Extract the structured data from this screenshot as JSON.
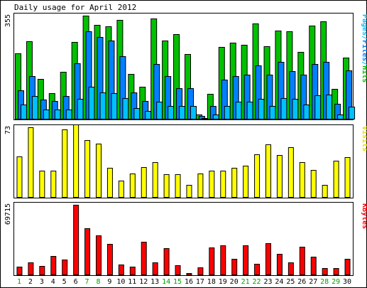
{
  "chart_data": {
    "type": "bar",
    "title": "Daily usage for April 2012",
    "days": [
      "1",
      "2",
      "3",
      "4",
      "5",
      "6",
      "7",
      "8",
      "9",
      "10",
      "11",
      "12",
      "13",
      "14",
      "15",
      "16",
      "17",
      "18",
      "19",
      "20",
      "21",
      "22",
      "23",
      "24",
      "25",
      "26",
      "27",
      "28",
      "29",
      "30"
    ],
    "weekend_days": [
      "1",
      "7",
      "8",
      "14",
      "15",
      "21",
      "22",
      "28",
      "29"
    ],
    "panels": [
      {
        "id": "pages",
        "max_label": "355",
        "ymax": 355,
        "legend": [
          {
            "text": "Pages",
            "color": "#00C0FF"
          },
          {
            "text": "/",
            "color": "#00C0FF"
          },
          {
            "text": "Files",
            "color": "#0080FF"
          },
          {
            "text": "/",
            "color": "#00C0FF"
          },
          {
            "text": "Hits",
            "color": "#00C000"
          }
        ],
        "series": [
          {
            "name": "Hits",
            "color": "#00C000",
            "values": [
              225,
              267,
              138,
              91,
              163,
              264,
              355,
              324,
              319,
              341,
              155,
              112,
              345,
              269,
              292,
              224,
              16,
              88,
              248,
              263,
              255,
              328,
              250,
              303,
              302,
              230,
              322,
              336,
              104,
              211
            ]
          },
          {
            "name": "Files",
            "color": "#0080FF",
            "values": [
              100,
              148,
              69,
              64,
              80,
              193,
              302,
              282,
              271,
              216,
              93,
              64,
              190,
              149,
              106,
              106,
              11,
              47,
              137,
              148,
              154,
              186,
              154,
              197,
              166,
              154,
              189,
              198,
              54,
              167
            ]
          },
          {
            "name": "Pages",
            "color": "#00C0FF",
            "values": [
              50,
              80,
              33,
              34,
              34,
              71,
              112,
              92,
              91,
              73,
              38,
              30,
              62,
              47,
              47,
              47,
              5,
              18,
              45,
              62,
              62,
              71,
              45,
              73,
              70,
              52,
              83,
              86,
              18,
              44
            ]
          }
        ]
      },
      {
        "id": "visits",
        "max_label": "73",
        "ymax": 73,
        "legend": [
          {
            "text": "Visits",
            "color": "#E0E000"
          }
        ],
        "series": [
          {
            "name": "Visits",
            "color": "#FFFF00",
            "values": [
              43,
              73,
              28,
              28,
              71,
              76,
              60,
              56,
              31,
              18,
              25,
              32,
              37,
              24,
              24,
              13,
              25,
              28,
              28,
              31,
              33,
              45,
              55,
              44,
              52,
              37,
              29,
              13,
              38,
              42
            ]
          }
        ]
      },
      {
        "id": "kbytes",
        "max_label": "69715",
        "ymax": 69715,
        "legend": [
          {
            "text": "KBytes",
            "color": "#FF0000"
          }
        ],
        "series": [
          {
            "name": "KBytes",
            "color": "#FF0000",
            "values": [
              8400,
              12600,
              9400,
              19200,
              15500,
              69715,
              46200,
              39500,
              31300,
              10800,
              8300,
              33300,
              12600,
              27100,
              10200,
              2300,
              7400,
              27300,
              29300,
              15900,
              29500,
              11600,
              31500,
              20900,
              13000,
              28300,
              18300,
              7300,
              7300,
              16200
            ]
          }
        ]
      }
    ]
  }
}
